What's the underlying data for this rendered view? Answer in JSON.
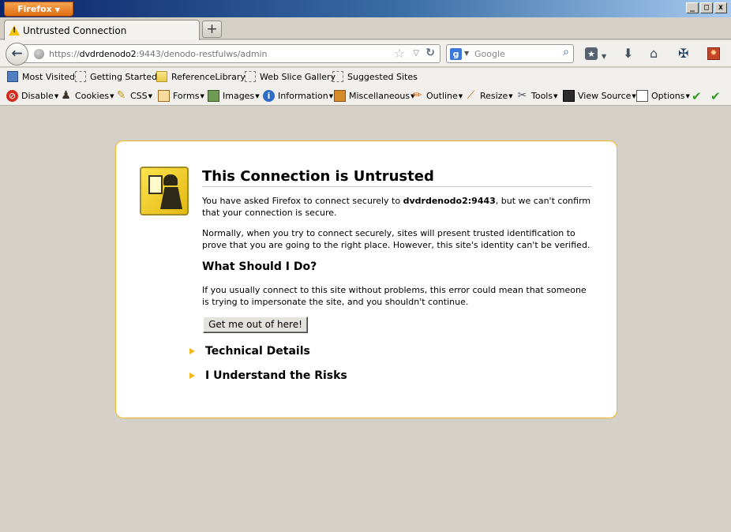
{
  "app": {
    "menu_label": "Firefox",
    "window_controls": {
      "minimize": "_",
      "maximize": "□",
      "close": "x"
    }
  },
  "tabs": [
    {
      "title": "Untrusted Connection",
      "icon": "warning-icon"
    }
  ],
  "new_tab_label": "+",
  "navbar": {
    "url_prefix": "https://",
    "url_host": "dvdrdenodo2",
    "url_rest": ":9443/denodo-restfulws/admin",
    "search_placeholder": "Google",
    "search_engine_letter": "g"
  },
  "bookmarks": [
    {
      "label": "Most Visited",
      "icon": "most-visited-icon"
    },
    {
      "label": "Getting Started",
      "icon": "bookmark-icon"
    },
    {
      "label": "ReferenceLibrary",
      "icon": "folder-icon"
    },
    {
      "label": "Web Slice Gallery",
      "icon": "bookmark-icon"
    },
    {
      "label": "Suggested Sites",
      "icon": "bookmark-icon"
    }
  ],
  "devtoolbar": [
    {
      "label": "Disable",
      "icon": "disable-icon"
    },
    {
      "label": "Cookies",
      "icon": "cookies-icon"
    },
    {
      "label": "CSS",
      "icon": "css-icon"
    },
    {
      "label": "Forms",
      "icon": "forms-icon"
    },
    {
      "label": "Images",
      "icon": "images-icon"
    },
    {
      "label": "Information",
      "icon": "information-icon"
    },
    {
      "label": "Miscellaneous",
      "icon": "miscellaneous-icon"
    },
    {
      "label": "Outline",
      "icon": "outline-icon"
    },
    {
      "label": "Resize",
      "icon": "resize-icon"
    },
    {
      "label": "Tools",
      "icon": "tools-icon"
    },
    {
      "label": "View Source",
      "icon": "view-source-icon"
    },
    {
      "label": "Options",
      "icon": "options-icon"
    }
  ],
  "error": {
    "title": "This Connection is Untrusted",
    "p1_before": "You have asked Firefox to connect securely to ",
    "p1_host": "dvdrdenodo2:9443",
    "p1_after": ", but we can't confirm that your connection is secure.",
    "p2": "Normally, when you try to connect securely, sites will present trusted identification to prove that you are going to the right place. However, this site's identity can't be verified.",
    "subhead": "What Should I Do?",
    "p3": "If you usually connect to this site without problems, this error could mean that someone is trying to impersonate the site, and you shouldn't continue.",
    "button": "Get me out of here!",
    "expanders": [
      "Technical Details",
      "I Understand the Risks"
    ]
  },
  "colors": {
    "accent_border": "#f5b923",
    "expander_triangle": "#f3b81b",
    "firefox_button": "#e06d13"
  }
}
